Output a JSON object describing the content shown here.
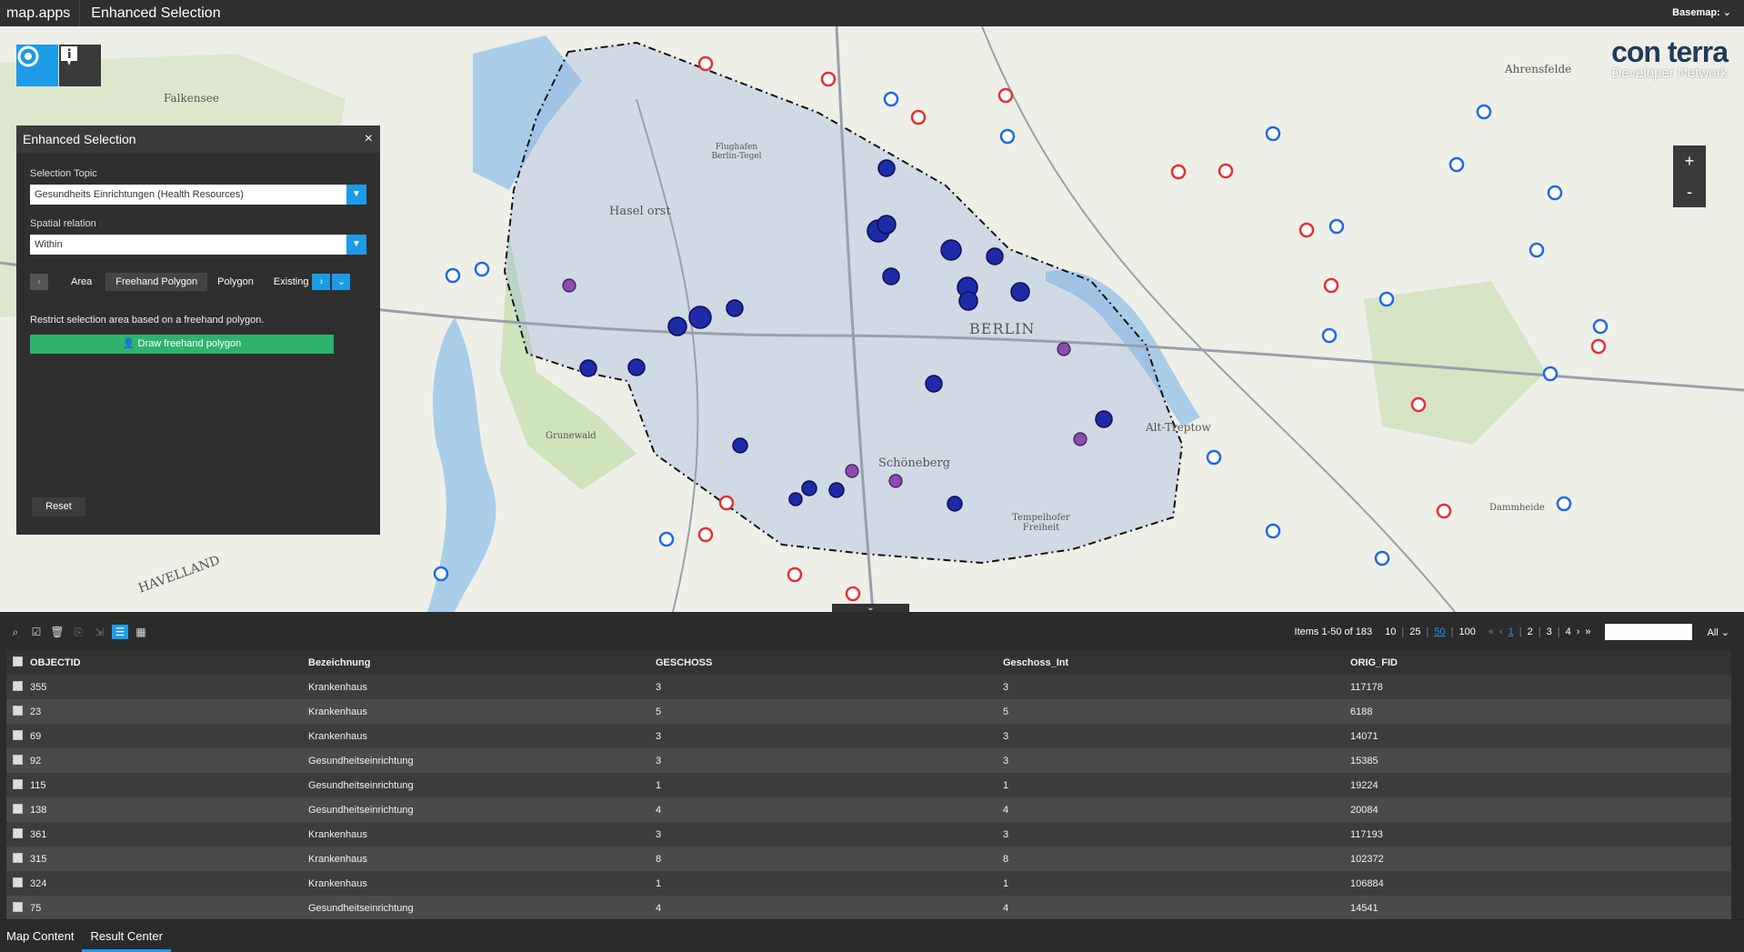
{
  "app": {
    "brand": "map.apps",
    "title": "Enhanced Selection",
    "basemap_label": "Basemap:"
  },
  "map": {
    "zoom_in": "+",
    "zoom_out": "-",
    "logo_main": "con terra",
    "logo_sub": "Developer Network",
    "labels": [
      "BERLIN",
      "Schöneberg",
      "Hasel orst",
      "Grunewald",
      "Tempelhofer Freiheit",
      "Alt-Treptow",
      "HAVELLAND",
      "Ahrensfelde",
      "Flughafen Berlin-Tegel",
      "Dammheide",
      "Falkensee"
    ],
    "accent_colors": {
      "selection": "#1f2aa8",
      "hospital": "#1e6ae0",
      "clinic": "#e53030"
    }
  },
  "widget": {
    "title": "Enhanced Selection",
    "close": "×",
    "selection_topic_label": "Selection Topic",
    "selection_topic_value": "Gesundheits Einrichtungen (Health Resources)",
    "spatial_relation_label": "Spatial relation",
    "spatial_relation_value": "Within",
    "tabs": [
      "Area",
      "Freehand Polygon",
      "Polygon",
      "Existing"
    ],
    "active_tab": "Freehand Polygon",
    "hint": "Restrict selection area based on a freehand polygon.",
    "draw_button": "Draw freehand polygon",
    "reset_button": "Reset"
  },
  "grid_toolbar": {
    "items_text": "Items 1-50 of 183",
    "page_sizes": [
      "10",
      "25",
      "50",
      "100"
    ],
    "selected_page_size": "50",
    "pages": [
      "1",
      "2",
      "3",
      "4"
    ],
    "current_page": "1",
    "filter_scope": "All"
  },
  "table": {
    "columns": [
      "OBJECTID",
      "Bezeichnung",
      "GESCHOSS",
      "Geschoss_Int",
      "ORIG_FID"
    ],
    "rows": [
      [
        "355",
        "Krankenhaus",
        "3",
        "3",
        "117178"
      ],
      [
        "23",
        "Krankenhaus",
        "5",
        "5",
        "6188"
      ],
      [
        "69",
        "Krankenhaus",
        "3",
        "3",
        "14071"
      ],
      [
        "92",
        "Gesundheitseinrichtung",
        "3",
        "3",
        "15385"
      ],
      [
        "115",
        "Gesundheitseinrichtung",
        "1",
        "1",
        "19224"
      ],
      [
        "138",
        "Gesundheitseinrichtung",
        "4",
        "4",
        "20084"
      ],
      [
        "361",
        "Krankenhaus",
        "3",
        "3",
        "117193"
      ],
      [
        "315",
        "Krankenhaus",
        "8",
        "8",
        "102372"
      ],
      [
        "324",
        "Krankenhaus",
        "1",
        "1",
        "106884"
      ],
      [
        "75",
        "Gesundheitseinrichtung",
        "4",
        "4",
        "14541"
      ]
    ]
  },
  "bottom_tabs": [
    "Map Content",
    "Result Center"
  ],
  "active_bottom_tab": "Result Center"
}
